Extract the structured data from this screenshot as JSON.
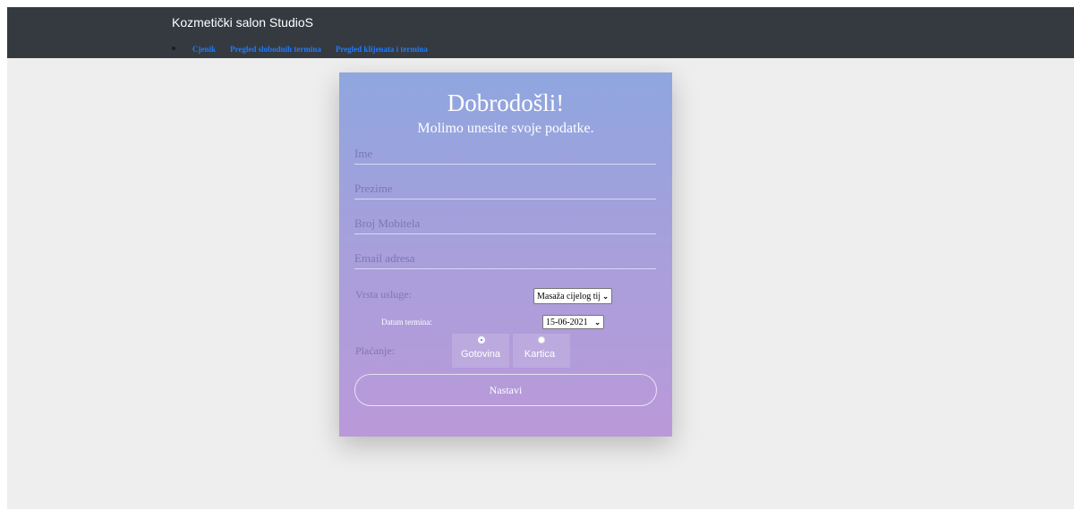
{
  "navbar": {
    "brand": "Kozmetički salon StudioS",
    "links": [
      "Cjenik",
      "Pregled slobodnih termina",
      "Pregled klijenata i termina"
    ]
  },
  "form": {
    "title": "Dobrodošli!",
    "subtitle": "Molimo unesite svoje podatke.",
    "fields": {
      "ime": "Ime",
      "prezime": "Prezime",
      "mobitel": "Broj Mobitela",
      "email": "Email adresa"
    },
    "service_label": "Vrsta usluge:",
    "service_value": "Masaža cijelog tijela",
    "date_label": "Datum termina:",
    "date_value": "15-06-2021",
    "payment_label": "Plaćanje:",
    "payment_options": [
      {
        "label": "Gotovina",
        "selected": true
      },
      {
        "label": "Kartica",
        "selected": false
      }
    ],
    "submit": "Nastavi"
  },
  "colors": {
    "navbar": "#343a40",
    "link": "#1e7bff",
    "card_top": "#8fa6df",
    "card_bottom": "#ba99d9"
  }
}
